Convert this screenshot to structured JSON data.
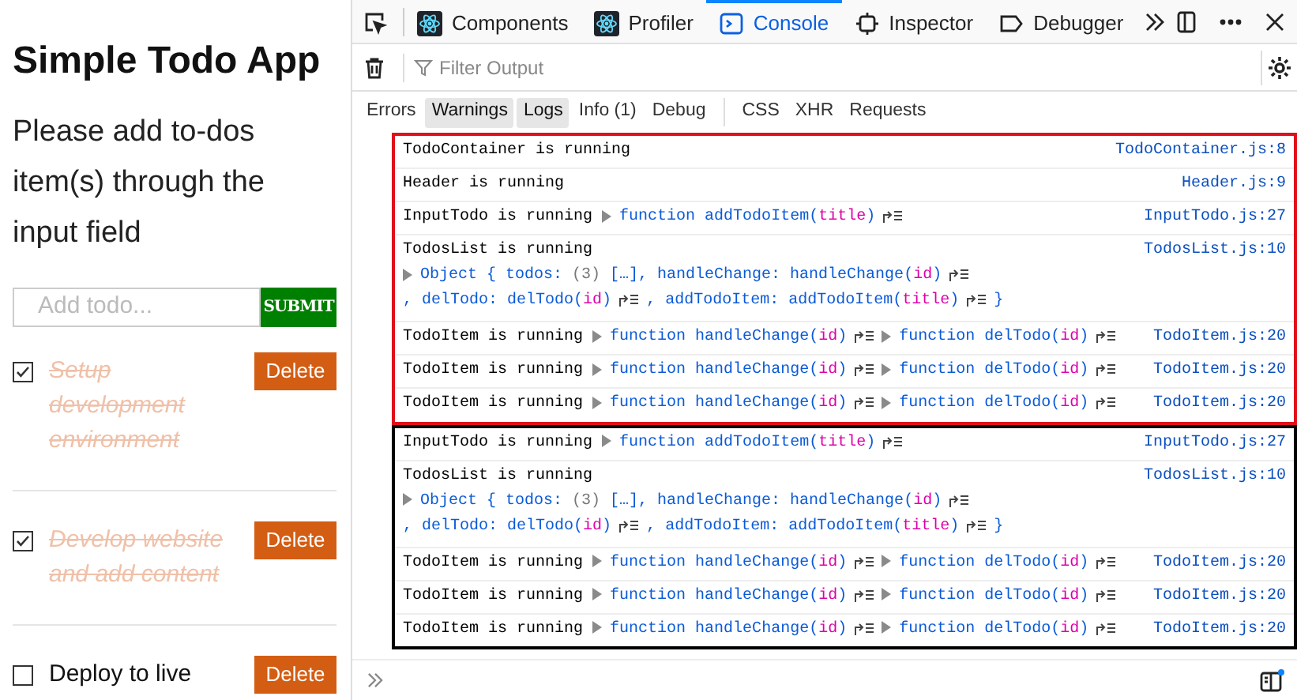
{
  "app": {
    "title": "Simple Todo App",
    "description": "Please add to-dos item(s) through the input field",
    "input": {
      "placeholder": "Add todo..."
    },
    "submit": "SUBMIT",
    "todos": [
      {
        "title": "Setup development environment",
        "checked": true,
        "delete": "Delete"
      },
      {
        "title": "Develop website and add content",
        "checked": true,
        "delete": "Delete"
      },
      {
        "title": "Deploy to live",
        "checked": false,
        "delete": "Delete"
      }
    ]
  },
  "devtools": {
    "tabs": [
      {
        "label": "Components",
        "selected": false
      },
      {
        "label": "Profiler",
        "selected": false
      },
      {
        "label": "Console",
        "selected": true
      },
      {
        "label": "Inspector",
        "selected": false
      },
      {
        "label": "Debugger",
        "selected": false
      }
    ],
    "filter": {
      "placeholder": "Filter Output"
    },
    "level_filters": [
      {
        "label": "Errors",
        "selected": false
      },
      {
        "label": "Warnings",
        "selected": true
      },
      {
        "label": "Logs",
        "selected": true
      },
      {
        "label": "Info (1)",
        "selected": false
      },
      {
        "label": "Debug",
        "selected": false
      }
    ],
    "request_filters": [
      {
        "label": "CSS",
        "selected": false
      },
      {
        "label": "XHR",
        "selected": false
      },
      {
        "label": "Requests",
        "selected": false
      }
    ],
    "groups": [
      {
        "color": "#e0101a",
        "messages": [
          {
            "text": "TodoContainer is running",
            "source": "TodoContainer.js:8",
            "kind": "inline"
          },
          {
            "text": "Header is running",
            "source": "Header.js:9",
            "kind": "inline"
          },
          {
            "text": "InputTodo is running",
            "source": "InputTodo.js:27",
            "kind": "inline",
            "parts": [
              {
                "kind": "arrow"
              },
              {
                "kind": "code",
                "text": "function addTodoItem("
              },
              {
                "kind": "param",
                "text": "title"
              },
              {
                "kind": "code",
                "text": ")"
              },
              {
                "kind": "jump"
              }
            ]
          },
          {
            "text": "TodosList is running",
            "source": "TodosList.js:10",
            "kind": "block",
            "parts": [
              {
                "kind": "arrow"
              },
              {
                "kind": "code",
                "text": "Object { todos: "
              },
              {
                "kind": "muted",
                "text": "(3)"
              },
              {
                "kind": "code",
                "text": " […], handleChange: handleChange("
              },
              {
                "kind": "param",
                "text": "id"
              },
              {
                "kind": "code",
                "text": ")"
              },
              {
                "kind": "jump"
              },
              {
                "kind": "code",
                "text": ", delTodo: delTodo("
              },
              {
                "kind": "param",
                "text": "id"
              },
              {
                "kind": "code",
                "text": ")"
              },
              {
                "kind": "jump"
              },
              {
                "kind": "code",
                "text": ", addTodoItem: addTodoItem("
              },
              {
                "kind": "param",
                "text": "title"
              },
              {
                "kind": "code",
                "text": ")"
              },
              {
                "kind": "jump"
              },
              {
                "kind": "code",
                "text": "}"
              }
            ]
          },
          {
            "text": "TodoItem is running",
            "source": "TodoItem.js:20",
            "kind": "inline",
            "parts": [
              {
                "kind": "arrow"
              },
              {
                "kind": "code",
                "text": "function handleChange("
              },
              {
                "kind": "param",
                "text": "id"
              },
              {
                "kind": "code",
                "text": ")"
              },
              {
                "kind": "jump"
              },
              {
                "kind": "arrow"
              },
              {
                "kind": "code",
                "text": "function delTodo("
              },
              {
                "kind": "param",
                "text": "id"
              },
              {
                "kind": "code",
                "text": ")"
              },
              {
                "kind": "jump"
              }
            ]
          },
          {
            "text": "TodoItem is running",
            "source": "TodoItem.js:20",
            "kind": "inline",
            "parts": [
              {
                "kind": "arrow"
              },
              {
                "kind": "code",
                "text": "function handleChange("
              },
              {
                "kind": "param",
                "text": "id"
              },
              {
                "kind": "code",
                "text": ")"
              },
              {
                "kind": "jump"
              },
              {
                "kind": "arrow"
              },
              {
                "kind": "code",
                "text": "function delTodo("
              },
              {
                "kind": "param",
                "text": "id"
              },
              {
                "kind": "code",
                "text": ")"
              },
              {
                "kind": "jump"
              }
            ]
          },
          {
            "text": "TodoItem is running",
            "source": "TodoItem.js:20",
            "kind": "inline",
            "parts": [
              {
                "kind": "arrow"
              },
              {
                "kind": "code",
                "text": "function handleChange("
              },
              {
                "kind": "param",
                "text": "id"
              },
              {
                "kind": "code",
                "text": ")"
              },
              {
                "kind": "jump"
              },
              {
                "kind": "arrow"
              },
              {
                "kind": "code",
                "text": "function delTodo("
              },
              {
                "kind": "param",
                "text": "id"
              },
              {
                "kind": "code",
                "text": ")"
              },
              {
                "kind": "jump"
              }
            ]
          }
        ]
      },
      {
        "color": "#000000",
        "messages": [
          {
            "text": "InputTodo is running",
            "source": "InputTodo.js:27",
            "kind": "inline",
            "parts": [
              {
                "kind": "arrow"
              },
              {
                "kind": "code",
                "text": "function addTodoItem("
              },
              {
                "kind": "param",
                "text": "title"
              },
              {
                "kind": "code",
                "text": ")"
              },
              {
                "kind": "jump"
              }
            ]
          },
          {
            "text": "TodosList is running",
            "source": "TodosList.js:10",
            "kind": "block",
            "parts": [
              {
                "kind": "arrow"
              },
              {
                "kind": "code",
                "text": "Object { todos: "
              },
              {
                "kind": "muted",
                "text": "(3)"
              },
              {
                "kind": "code",
                "text": " […], handleChange: handleChange("
              },
              {
                "kind": "param",
                "text": "id"
              },
              {
                "kind": "code",
                "text": ")"
              },
              {
                "kind": "jump"
              },
              {
                "kind": "code",
                "text": ", delTodo: delTodo("
              },
              {
                "kind": "param",
                "text": "id"
              },
              {
                "kind": "code",
                "text": ")"
              },
              {
                "kind": "jump"
              },
              {
                "kind": "code",
                "text": ", addTodoItem: addTodoItem("
              },
              {
                "kind": "param",
                "text": "title"
              },
              {
                "kind": "code",
                "text": ")"
              },
              {
                "kind": "jump"
              },
              {
                "kind": "code",
                "text": "}"
              }
            ]
          },
          {
            "text": "TodoItem is running",
            "source": "TodoItem.js:20",
            "kind": "inline",
            "parts": [
              {
                "kind": "arrow"
              },
              {
                "kind": "code",
                "text": "function handleChange("
              },
              {
                "kind": "param",
                "text": "id"
              },
              {
                "kind": "code",
                "text": ")"
              },
              {
                "kind": "jump"
              },
              {
                "kind": "arrow"
              },
              {
                "kind": "code",
                "text": "function delTodo("
              },
              {
                "kind": "param",
                "text": "id"
              },
              {
                "kind": "code",
                "text": ")"
              },
              {
                "kind": "jump"
              }
            ]
          },
          {
            "text": "TodoItem is running",
            "source": "TodoItem.js:20",
            "kind": "inline",
            "parts": [
              {
                "kind": "arrow"
              },
              {
                "kind": "code",
                "text": "function handleChange("
              },
              {
                "kind": "param",
                "text": "id"
              },
              {
                "kind": "code",
                "text": ")"
              },
              {
                "kind": "jump"
              },
              {
                "kind": "arrow"
              },
              {
                "kind": "code",
                "text": "function delTodo("
              },
              {
                "kind": "param",
                "text": "id"
              },
              {
                "kind": "code",
                "text": ")"
              },
              {
                "kind": "jump"
              }
            ]
          },
          {
            "text": "TodoItem is running",
            "source": "TodoItem.js:20",
            "kind": "inline",
            "parts": [
              {
                "kind": "arrow"
              },
              {
                "kind": "code",
                "text": "function handleChange("
              },
              {
                "kind": "param",
                "text": "id"
              },
              {
                "kind": "code",
                "text": ")"
              },
              {
                "kind": "jump"
              },
              {
                "kind": "arrow"
              },
              {
                "kind": "code",
                "text": "function delTodo("
              },
              {
                "kind": "param",
                "text": "id"
              },
              {
                "kind": "code",
                "text": ")"
              },
              {
                "kind": "jump"
              }
            ]
          }
        ]
      }
    ]
  }
}
